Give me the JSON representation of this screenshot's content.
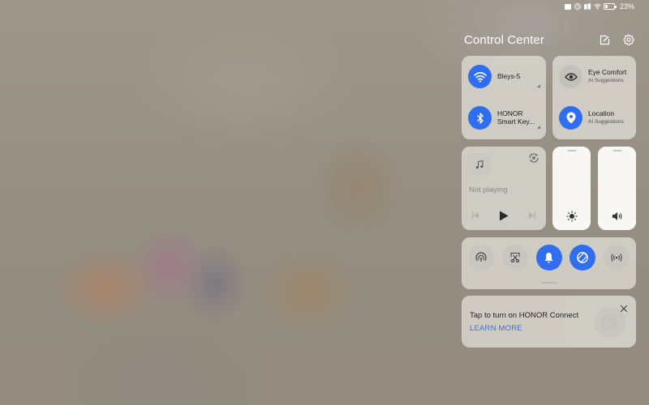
{
  "status_bar": {
    "icons": [
      "notification-icon",
      "clock-icon",
      "signal-icon",
      "wifi-icon",
      "battery-icon"
    ],
    "battery_percent": "23%",
    "battery_level": 0.23
  },
  "control_center": {
    "title": "Control Center",
    "edit_icon": "edit-icon",
    "settings_icon": "gear-icon"
  },
  "connectivity": {
    "wifi": {
      "label": "Bleys-5",
      "state": "on",
      "icon": "wifi-icon"
    },
    "bluetooth": {
      "label_line1": "HONOR",
      "label_line2": "Smart Key...",
      "state": "on",
      "icon": "bluetooth-icon"
    }
  },
  "ai_tiles": {
    "eye_comfort": {
      "label": "Eye Comfort",
      "sub": "AI Suggestions",
      "state": "off",
      "icon": "eye-icon"
    },
    "location": {
      "label": "Location",
      "sub": "AI Suggestions",
      "state": "on",
      "icon": "location-icon"
    }
  },
  "media": {
    "status": "Not playing",
    "album_icon": "music-note-icon",
    "controls": [
      "previous",
      "play",
      "next"
    ]
  },
  "sliders": {
    "brightness": {
      "level": 1.0,
      "icon": "sun-icon"
    },
    "volume": {
      "level": 1.0,
      "icon": "speaker-icon"
    }
  },
  "toggles": [
    {
      "name": "hotspot",
      "icon": "hotspot-icon",
      "state": "off"
    },
    {
      "name": "screenshot",
      "icon": "screenshot-scissors-icon",
      "state": "off"
    },
    {
      "name": "sound",
      "icon": "bell-icon",
      "state": "on"
    },
    {
      "name": "auto-rotate",
      "icon": "rotate-icon",
      "state": "on"
    },
    {
      "name": "nfc",
      "icon": "nfc-icon",
      "state": "off"
    }
  ],
  "honor_connect": {
    "message": "Tap to turn on HONOR Connect",
    "link": "LEARN MORE"
  },
  "colors": {
    "accent": "#2f6ef0",
    "link": "#3a6fd8"
  }
}
